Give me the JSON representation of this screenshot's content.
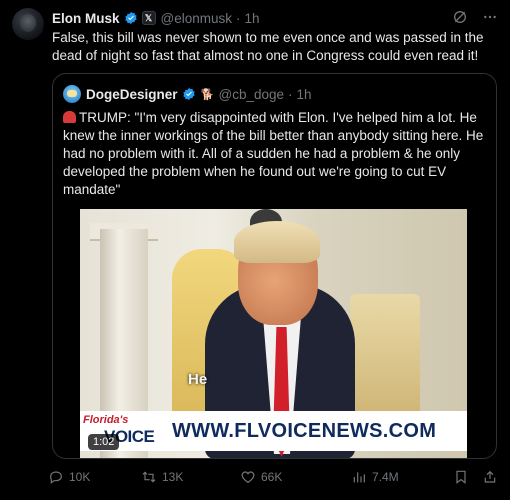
{
  "post": {
    "author_name": "Elon Musk",
    "handle": "@elonmusk",
    "separator": "·",
    "time": "1h",
    "text": "False, this bill was never shown to me even once and was passed in the dead of night so fast that almost no one in Congress could even read it!"
  },
  "quote": {
    "author_name": "DogeDesigner",
    "handle": "@cb_doge",
    "separator": "·",
    "time": "1h",
    "text": "TRUMP: \"I'm very disappointed with Elon. I've helped him a lot. He knew the inner workings of the bill better than anybody sitting here. He had no problem with it. All of a sudden he had a problem & he only developed the problem when he found out we're going to cut EV mandate\""
  },
  "video": {
    "caption_word": "He",
    "logo_line1": "Florida's",
    "logo_line2": "VOICE",
    "banner_url": "WWW.FLVOICENEWS.COM",
    "timestamp": "1:02"
  },
  "actions": {
    "replies": "10K",
    "reposts": "13K",
    "likes": "66K",
    "views": "7.4M"
  },
  "colors": {
    "verified": "#1d9bf0",
    "muted": "#71767b",
    "border": "#2f3336",
    "tie": "#d2202a"
  }
}
